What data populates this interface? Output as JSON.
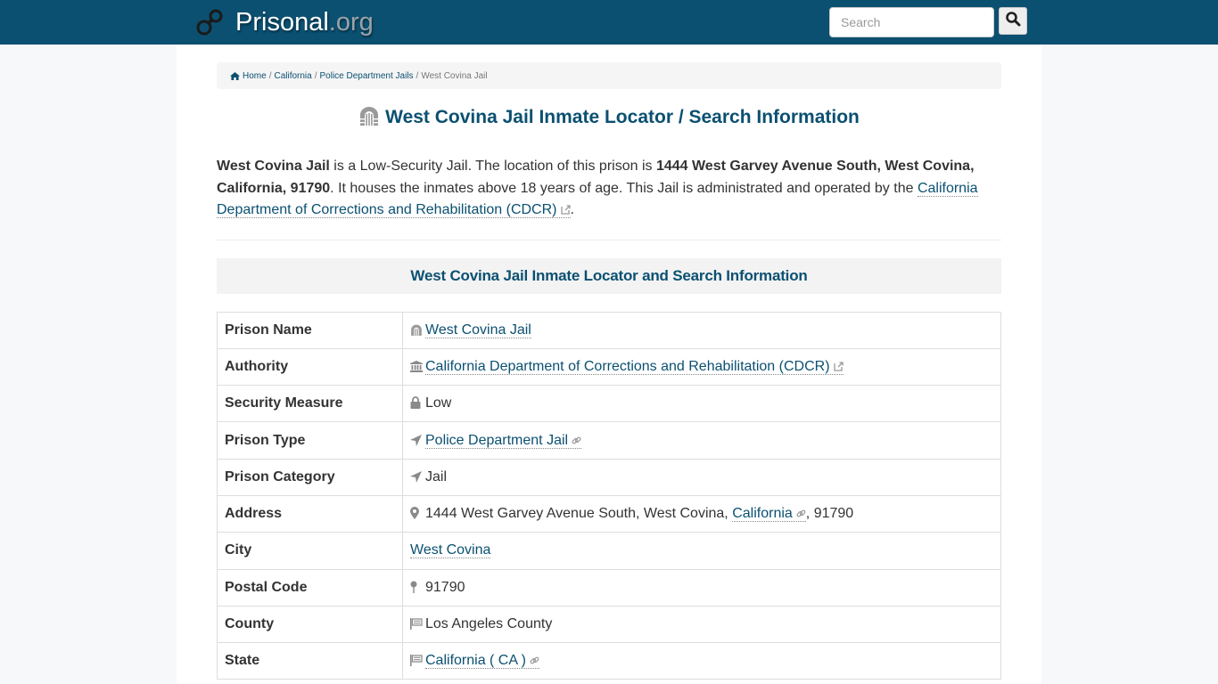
{
  "header": {
    "brand_name": "Prisonal",
    "brand_tld": ".org",
    "search_placeholder": "Search",
    "search_value": ""
  },
  "colors": {
    "header_bg": "#0b5071",
    "accent": "#0b5071",
    "page_bg": "#f7f8fa"
  },
  "breadcrumb": {
    "items": [
      {
        "label": "Home",
        "icon": "home-icon"
      },
      {
        "label": "California"
      },
      {
        "label": "Police Department Jails"
      },
      {
        "label": "West Covina Jail"
      }
    ],
    "separator": "/"
  },
  "page": {
    "title": "West Covina Jail Inmate Locator / Search Information",
    "title_icon": "prison-gate-icon"
  },
  "intro": {
    "name": "West Covina Jail",
    "text1": " is a Low-Security Jail. The location of this prison is ",
    "address": "1444 West Garvey Avenue South, West Covina, California, 91790",
    "text2": ". It houses the inmates above 18 years of age. This Jail is administrated and operated by the ",
    "authority_link": "California Department of Corrections and Rehabilitation (CDCR)",
    "text3": "."
  },
  "section": {
    "heading": "West Covina Jail Inmate Locator and Search Information"
  },
  "table": {
    "rows": [
      {
        "key": "Prison Name",
        "icon": "prison-gate-icon",
        "value": "West Covina Jail",
        "link": true,
        "link_icon": null,
        "suffix": ""
      },
      {
        "key": "Authority",
        "icon": "institution-icon",
        "value": "California Department of Corrections and Rehabilitation (CDCR)",
        "link": true,
        "link_icon": "external-link-icon",
        "suffix": ""
      },
      {
        "key": "Security Measure",
        "icon": "lock-icon",
        "value": "Low",
        "link": false,
        "link_icon": null,
        "suffix": ""
      },
      {
        "key": "Prison Type",
        "icon": "location-arrow-icon",
        "value": "Police Department Jail",
        "link": true,
        "link_icon": "link-icon",
        "suffix": ""
      },
      {
        "key": "Prison Category",
        "icon": "location-arrow-icon",
        "value": "Jail",
        "link": false,
        "link_icon": null,
        "suffix": ""
      },
      {
        "key": "Address",
        "icon": "map-marker-icon",
        "prefix": "1444 West Garvey Avenue South, West Covina, ",
        "value": "California",
        "link": true,
        "link_icon": "link-icon",
        "suffix": ", 91790"
      },
      {
        "key": "City",
        "icon": null,
        "value": "West Covina",
        "link": true,
        "link_icon": null,
        "suffix": ""
      },
      {
        "key": "Postal Code",
        "icon": "map-pin-icon",
        "value": "91790",
        "link": false,
        "link_icon": null,
        "suffix": ""
      },
      {
        "key": "County",
        "icon": "flag-icon",
        "value": "Los Angeles County",
        "link": false,
        "link_icon": null,
        "suffix": ""
      },
      {
        "key": "State",
        "icon": "flag-icon",
        "value": "California ( CA )",
        "link": true,
        "link_icon": "link-icon",
        "suffix": ""
      }
    ]
  }
}
